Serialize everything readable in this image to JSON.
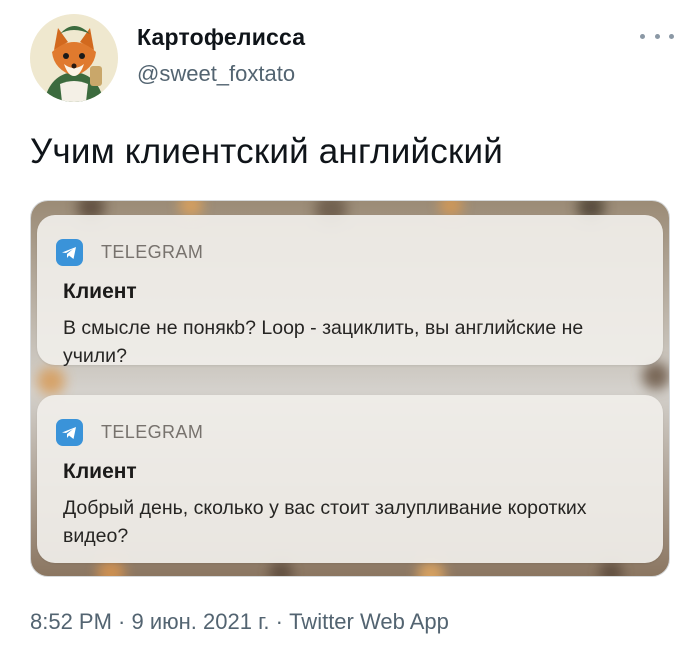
{
  "author": {
    "display_name": "Картофелисса",
    "handle": "@sweet_foxtato",
    "avatar_icon": "fox-avatar-icon"
  },
  "tweet_text": "Учим клиентский английский",
  "media": {
    "notifications": [
      {
        "app": "TELEGRAM",
        "app_icon": "telegram-icon",
        "sender": "Клиент",
        "message": "В смысле не понякb? Loop - зациклить, вы английские не учили?"
      },
      {
        "app": "TELEGRAM",
        "app_icon": "telegram-icon",
        "sender": "Клиент",
        "message": "Добрый день, сколько у вас стоит залупливание коротких видео?"
      }
    ]
  },
  "meta": {
    "time": "8:52 PM",
    "date": "9 июн. 2021 г.",
    "separator": " · ",
    "source": "Twitter Web App"
  },
  "colors": {
    "secondary_text": "#536471",
    "telegram_blue": "#3a93d9"
  }
}
